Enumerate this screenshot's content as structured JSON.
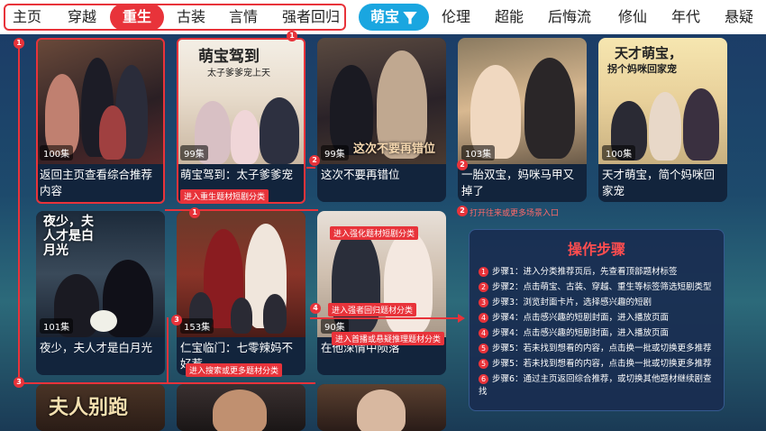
{
  "nav": {
    "tabs": [
      "主页",
      "穿越",
      "重生",
      "古装",
      "言情",
      "强者回归",
      "萌宝",
      "伦理",
      "超能",
      "后悔流",
      "修仙",
      "年代",
      "悬疑"
    ],
    "active_primary": "重生",
    "active_filter": "萌宝"
  },
  "cards": [
    {
      "poster_title": "",
      "episodes": "100集",
      "title": "返回主页查看综合推荐内容"
    },
    {
      "poster_title": "萌宝驾到",
      "poster_sub": "太子爹爹宠上天",
      "episodes": "99集",
      "title": "萌宝驾到：太子爹爹宠"
    },
    {
      "poster_title": "这次不要再错位",
      "episodes": "99集",
      "title": "这次不要再错位"
    },
    {
      "poster_title": "",
      "episodes": "103集",
      "title": "一胎双宝，妈咪马甲又掉了"
    },
    {
      "poster_title": "天才萌宝，",
      "poster_sub": "拐个妈咪回家宠",
      "episodes": "100集",
      "title": "天才萌宝，简个妈咪回家宠"
    },
    {
      "poster_title": "夜少，夫人才是白月光",
      "episodes": "101集",
      "title": "夜少，夫人才是白月光"
    },
    {
      "poster_title": "",
      "episodes": "153集",
      "title": "仁宝临门：七零辣妈不好惹"
    },
    {
      "poster_title": "",
      "episodes": "90集",
      "title": "在他深情中陨落"
    },
    {
      "poster_title": "夫人别跑",
      "episodes": "",
      "title": ""
    },
    {
      "poster_title": "",
      "episodes": "",
      "title": ""
    },
    {
      "poster_title": "",
      "episodes": "",
      "title": ""
    }
  ],
  "annotations": {
    "a1": "1",
    "a2": "2",
    "a3": "3",
    "a4": "4",
    "tip_genre": "进入重生题材短剧分类",
    "tip_more": "打开往来或更多场景入口",
    "tip_genre2": "进入强化题材短剧分类",
    "tip_search": "进入搜索或更多题材分类",
    "tip_sub": "进入首播或悬疑推理题材分类",
    "tip_back": "进入强者回归题材分类"
  },
  "steps_panel": {
    "title": "操作步骤",
    "steps": [
      {
        "num": "1",
        "text": "步骤1：进入分类推荐页后，先查看顶部题材标签"
      },
      {
        "num": "2",
        "text": "步骤2：点击萌宝、古装、穿越、重生等标签筛选短剧类型"
      },
      {
        "num": "3",
        "text": "步骤3：浏览封面卡片，选择感兴趣的短剧"
      },
      {
        "num": "4",
        "text": "步骤4：点击感兴趣的短剧封面，进入播放页面"
      },
      {
        "num": "4",
        "text": "步骤4：点击感兴趣的短剧封面，进入播放页面"
      },
      {
        "num": "5",
        "text": "步骤5：若未找到想看的内容，点击换一批或切换更多推荐"
      },
      {
        "num": "5",
        "text": "步骤5：若未找到想看的内容，点击换一批或切换更多推荐"
      },
      {
        "num": "6",
        "text": "步骤6：通过主页返回综合推荐，或切换其他题材继续剧查找"
      }
    ]
  },
  "colors": {
    "accent_red": "#e8333a",
    "accent_blue": "#1aa6e0"
  }
}
